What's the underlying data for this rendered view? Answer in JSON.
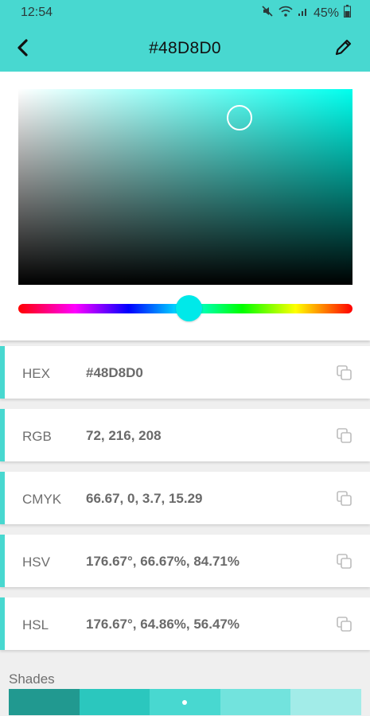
{
  "status_bar": {
    "time": "12:54",
    "battery": "45%",
    "icons": [
      "mute-icon",
      "wifi-icon",
      "signal-icon",
      "battery-icon"
    ]
  },
  "app_bar": {
    "title": "#48D8D0",
    "back_icon": "chevron-left-icon",
    "edit_icon": "pencil-icon",
    "accent_color": "#48D8D0"
  },
  "picker": {
    "hue_degrees": 176.67,
    "saturation_fraction": 0.6667,
    "value_fraction": 0.8471
  },
  "values": [
    {
      "label": "HEX",
      "value": "#48D8D0"
    },
    {
      "label": "RGB",
      "value": "72, 216, 208"
    },
    {
      "label": "CMYK",
      "value": "66.67, 0, 3.7, 15.29"
    },
    {
      "label": "HSV",
      "value": "176.67°, 66.67%, 84.71%"
    },
    {
      "label": "HSL",
      "value": "176.67°, 64.86%, 56.47%"
    }
  ],
  "shades": {
    "label": "Shades",
    "colors": [
      "#219990",
      "#2bc7be",
      "#48d8d0",
      "#72e3dd",
      "#a2ece8"
    ],
    "selected_index": 2
  }
}
